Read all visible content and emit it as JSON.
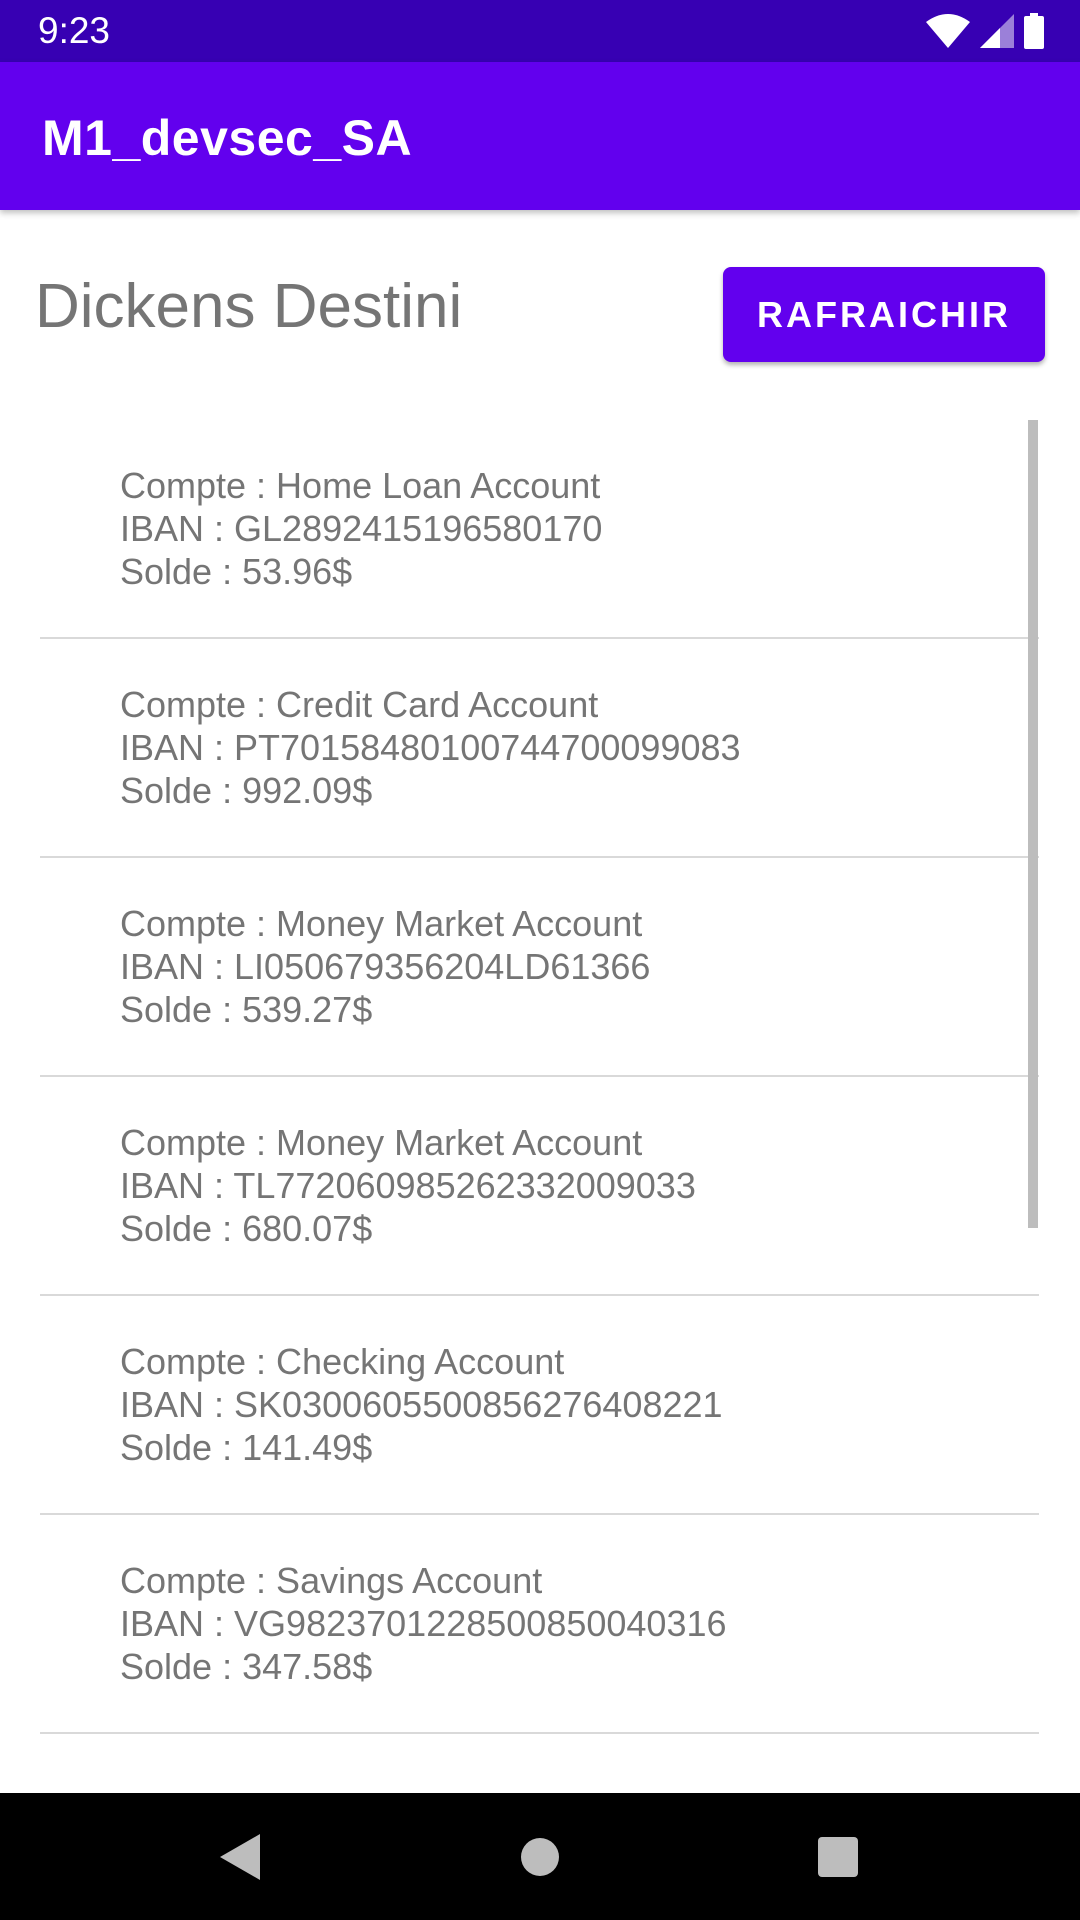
{
  "status_bar": {
    "time": "9:23",
    "icons": [
      "wifi-icon",
      "cell-signal-icon",
      "battery-icon"
    ]
  },
  "app_bar": {
    "title": "M1_devsec_SA"
  },
  "header": {
    "user_name": "Dickens Destini",
    "refresh_label": "RAFRAICHIR"
  },
  "accounts": [
    {
      "compte": "Compte : Home Loan Account",
      "iban": "IBAN : GL2892415196580170",
      "solde": "Solde : 53.96$"
    },
    {
      "compte": "Compte : Credit Card Account",
      "iban": "IBAN : PT70158480100744700099083",
      "solde": "Solde : 992.09$"
    },
    {
      "compte": "Compte : Money Market Account",
      "iban": "IBAN : LI050679356204LD61366",
      "solde": "Solde : 539.27$"
    },
    {
      "compte": "Compte : Money Market Account",
      "iban": "IBAN : TL772060985262332009033",
      "solde": "Solde : 680.07$"
    },
    {
      "compte": "Compte : Checking Account",
      "iban": "IBAN : SK0300605500856276408221",
      "solde": "Solde : 141.49$"
    },
    {
      "compte": "Compte : Savings Account",
      "iban": "IBAN : VG9823701228500850040316",
      "solde": "Solde : 347.58$"
    }
  ],
  "colors": {
    "status_bar": "#3700b3",
    "primary": "#6200ee",
    "text_secondary": "#757575"
  },
  "nav_bar": {
    "icons": [
      "back-icon",
      "home-icon",
      "recents-icon"
    ]
  }
}
